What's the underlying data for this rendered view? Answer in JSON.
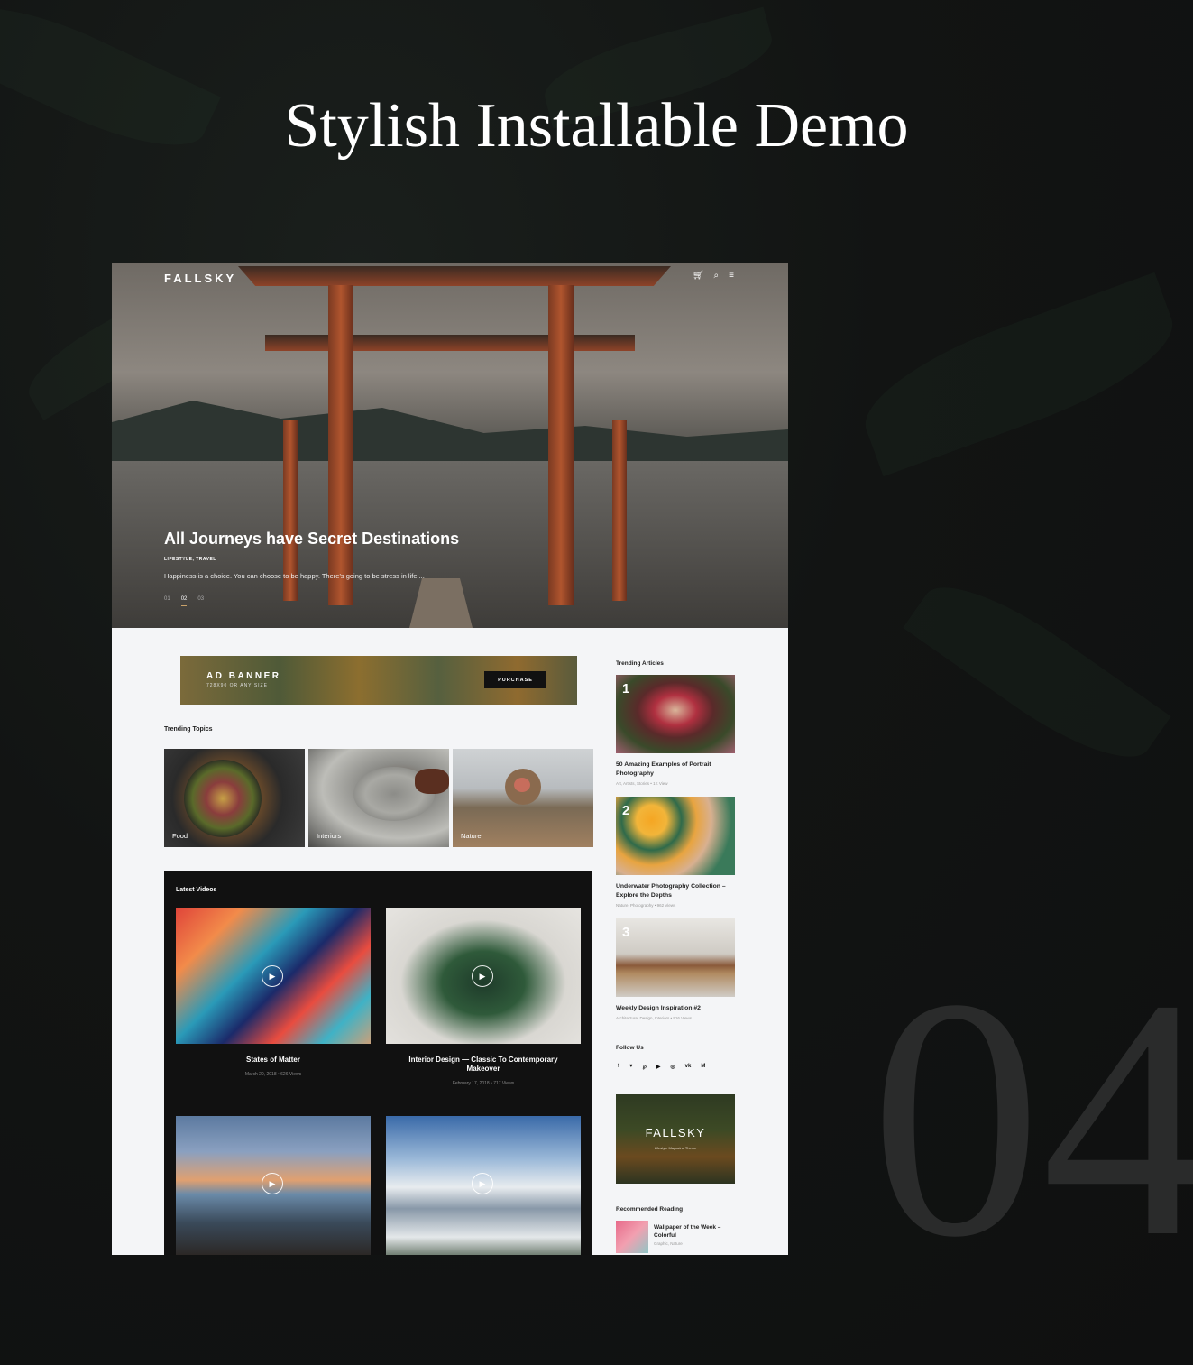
{
  "headline": "Stylish Installable Demo",
  "demo_number": "04",
  "site": {
    "logo": "FALLSKY",
    "nav_icons": [
      "cart-icon",
      "search-icon",
      "menu-icon"
    ]
  },
  "hero": {
    "title": "All Journeys have Secret Destinations",
    "categories": "LIFESTYLE, TRAVEL",
    "excerpt": "Happiness is a choice. You can choose to be happy. There's going to be stress in life,...",
    "pager": [
      "01",
      "02",
      "03"
    ],
    "active_slide": 2
  },
  "ad": {
    "title": "AD BANNER",
    "subtitle": "728X90 OR ANY SIZE",
    "button": "PURCHASE"
  },
  "trending_topics": {
    "title": "Trending Topics",
    "items": [
      {
        "label": "Food"
      },
      {
        "label": "Interiors"
      },
      {
        "label": "Nature"
      }
    ]
  },
  "latest_videos": {
    "title": "Latest Videos",
    "items": [
      {
        "title": "States of Matter",
        "meta": "March 20, 2018  •  626 Views"
      },
      {
        "title": "Interior Design — Classic To Contemporary Makeover",
        "meta": "February 17, 2018  •  717 Views"
      },
      {
        "title": "",
        "meta": ""
      },
      {
        "title": "",
        "meta": ""
      }
    ]
  },
  "trending_articles": {
    "title": "Trending Articles",
    "items": [
      {
        "num": "1",
        "title": "50 Amazing Examples of Portrait Photography",
        "meta": "Art, Artists, Stories  •  1K View"
      },
      {
        "num": "2",
        "title": "Underwater Photography Collection – Explore the Depths",
        "meta": "Nature, Photography  •  962 Views"
      },
      {
        "num": "3",
        "title": "Weekly Design Inspiration #2",
        "meta": "Architecture, Design, Interiors  •  916 Views"
      }
    ]
  },
  "follow": {
    "title": "Follow Us",
    "icons": [
      "facebook-icon",
      "twitter-icon",
      "pinterest-icon",
      "youtube-icon",
      "instagram-icon",
      "vk-icon",
      "medium-icon"
    ],
    "glyphs": [
      "f",
      "♥",
      "℘",
      "▶",
      "◎",
      "vk",
      "M"
    ]
  },
  "promo": {
    "logo": "FALLSKY",
    "tagline": "Lifestyle Magazine Theme"
  },
  "recommended": {
    "title": "Recommended Reading",
    "item_title": "Wallpaper of the Week – Colorful",
    "item_meta": "Graphic, Nature"
  }
}
